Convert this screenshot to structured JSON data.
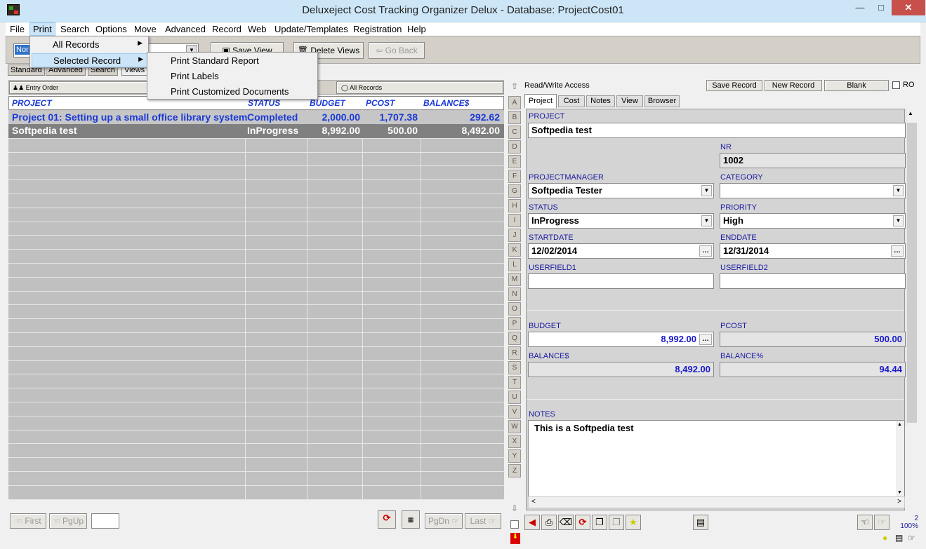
{
  "window": {
    "title": "Deluxeject Cost Tracking Organizer Delux - Database: ProjectCost01"
  },
  "menu": [
    "File",
    "Print",
    "Search",
    "Options",
    "Move",
    "Advanced",
    "Record",
    "Web",
    "Update/Templates",
    "Registration",
    "Help"
  ],
  "print_menu": {
    "items": [
      "All Records",
      "Selected Record"
    ],
    "submenu": [
      "Print Standard Report",
      "Print Labels",
      "Print Customized Documents"
    ]
  },
  "toolbar": {
    "view_select": "Nor",
    "save_view": "Save View",
    "delete_views": "Delete Views",
    "go_back": "Go Back"
  },
  "left_tabs": [
    "Standard",
    "Advanced",
    "Search",
    "Views"
  ],
  "sort": {
    "entry_order": "Entry Order",
    "all_records": "All Records"
  },
  "table": {
    "headers": [
      "PROJECT",
      "STATUS",
      "BUDGET",
      "PCOST",
      "BALANCE$"
    ],
    "rows": [
      {
        "project": "Project 01: Setting up a small office library system",
        "status": "Completed",
        "budget": "2,000.00",
        "pcost": "1,707.38",
        "balance": "292.62"
      },
      {
        "project": "Softpedia test",
        "status": "InProgress",
        "budget": "8,992.00",
        "pcost": "500.00",
        "balance": "8,492.00"
      }
    ]
  },
  "alphabet": [
    "A",
    "B",
    "C",
    "D",
    "E",
    "F",
    "G",
    "H",
    "I",
    "J",
    "K",
    "L",
    "M",
    "N",
    "O",
    "P",
    "Q",
    "R",
    "S",
    "T",
    "U",
    "V",
    "W",
    "X",
    "Y",
    "Z"
  ],
  "nav": {
    "first": "First",
    "pgup": "PgUp",
    "pgdn": "PgDn",
    "last": "Last"
  },
  "right_header": {
    "access": "Read/Write Access",
    "save": "Save Record",
    "new": "New Record",
    "blank": "Blank",
    "ro": "RO"
  },
  "record_tabs": [
    "Project",
    "Cost",
    "Notes",
    "View",
    "Browser"
  ],
  "form": {
    "project_label": "PROJECT",
    "project": "Softpedia test",
    "nr_label": "NR",
    "nr": "1002",
    "pm_label": "PROJECTMANAGER",
    "pm": "Softpedia Tester",
    "category_label": "CATEGORY",
    "category": "",
    "status_label": "STATUS",
    "status": "InProgress",
    "priority_label": "PRIORITY",
    "priority": "High",
    "startdate_label": "STARTDATE",
    "startdate": "12/02/2014",
    "enddate_label": "ENDDATE",
    "enddate": "12/31/2014",
    "uf1_label": "USERFIELD1",
    "uf1": "",
    "uf2_label": "USERFIELD2",
    "uf2": "",
    "budget_label": "BUDGET",
    "budget": "8,992.00",
    "pcost_label": "PCOST",
    "pcost": "500.00",
    "balance_label": "BALANCE$",
    "balance": "8,492.00",
    "balancepct_label": "BALANCE%",
    "balancepct": "94.44",
    "notes_label": "NOTES",
    "notes": "This is a Softpedia test"
  },
  "status": {
    "count": "2",
    "zoom": "100%"
  },
  "colors": {
    "selected_row": "#808080",
    "link_blue": "#1a3ad6",
    "menu_highlight": "#cce4f7"
  }
}
